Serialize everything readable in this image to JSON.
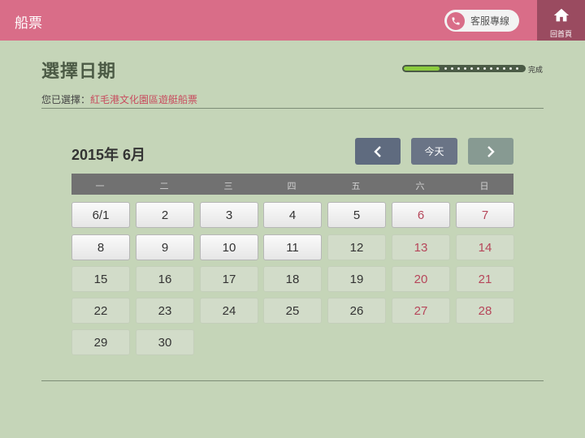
{
  "header": {
    "app_title": "船票",
    "service_label": "客服專線",
    "home_label": "回首頁"
  },
  "page": {
    "title": "選擇日期",
    "progress_label": "完成",
    "progress_fraction": 0.3,
    "selection_prefix": "您已選擇：",
    "selection_value": "紅毛港文化園區遊艇船票"
  },
  "calendar": {
    "month_label": "2015年 6月",
    "today_label": "今天",
    "weekdays": [
      "一",
      "二",
      "三",
      "四",
      "五",
      "六",
      "日"
    ],
    "days": [
      {
        "label": "6/1",
        "available": true
      },
      {
        "label": "2",
        "available": true
      },
      {
        "label": "3",
        "available": true
      },
      {
        "label": "4",
        "available": true
      },
      {
        "label": "5",
        "available": true
      },
      {
        "label": "6",
        "available": true
      },
      {
        "label": "7",
        "available": true
      },
      {
        "label": "8",
        "available": true
      },
      {
        "label": "9",
        "available": true
      },
      {
        "label": "10",
        "available": true
      },
      {
        "label": "11",
        "available": true
      },
      {
        "label": "12",
        "available": false
      },
      {
        "label": "13",
        "available": false
      },
      {
        "label": "14",
        "available": false
      },
      {
        "label": "15",
        "available": false
      },
      {
        "label": "16",
        "available": false
      },
      {
        "label": "17",
        "available": false
      },
      {
        "label": "18",
        "available": false
      },
      {
        "label": "19",
        "available": false
      },
      {
        "label": "20",
        "available": false
      },
      {
        "label": "21",
        "available": false
      },
      {
        "label": "22",
        "available": false
      },
      {
        "label": "23",
        "available": false
      },
      {
        "label": "24",
        "available": false
      },
      {
        "label": "25",
        "available": false
      },
      {
        "label": "26",
        "available": false
      },
      {
        "label": "27",
        "available": false
      },
      {
        "label": "28",
        "available": false
      },
      {
        "label": "29",
        "available": false
      },
      {
        "label": "30",
        "available": false
      }
    ]
  },
  "colors": {
    "header": "#d96d88",
    "home": "#9a4b60",
    "background": "#c5d5b8",
    "weekend_text": "#b6465a",
    "progress_fill": "#8ccc3f"
  },
  "icons": {
    "phone": "phone-icon",
    "home": "home-icon",
    "prev": "chevron-left-icon",
    "next": "chevron-right-icon"
  }
}
